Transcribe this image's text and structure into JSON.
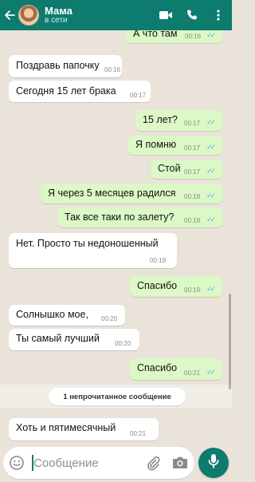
{
  "header": {
    "back_icon": "arrow-left-icon",
    "contact_name": "Мама",
    "status": "в сети",
    "icons": [
      "video-call-icon",
      "phone-icon",
      "more-vert-icon"
    ]
  },
  "messages": [
    {
      "dir": "out",
      "text": "А что там",
      "time": "00:16",
      "read": true
    },
    {
      "dir": "in",
      "text": "Поздравь папочку",
      "time": "00:16"
    },
    {
      "dir": "in",
      "text": "Сегодня 15 лет брака",
      "time": "00:17"
    },
    {
      "dir": "out",
      "text": "15 лет?",
      "time": "00:17",
      "read": true
    },
    {
      "dir": "out",
      "text": "Я помню",
      "time": "00:17",
      "read": true
    },
    {
      "dir": "out",
      "text": "Стой",
      "time": "00:17",
      "read": true
    },
    {
      "dir": "out",
      "text": "Я через 5 месяцев радился",
      "time": "00:18",
      "read": true
    },
    {
      "dir": "out",
      "text": "Так все таки по залету?",
      "time": "00:18",
      "read": true
    },
    {
      "dir": "in",
      "text": "Нет. Просто ты недоношенный",
      "time": "00:19"
    },
    {
      "dir": "out",
      "text": "Спасибо",
      "time": "00:19",
      "read": true
    },
    {
      "dir": "in",
      "text": "Солнышко мое,",
      "time": "00:20"
    },
    {
      "dir": "in",
      "text": "Ты самый лучший",
      "time": "00:20"
    },
    {
      "dir": "out",
      "text": "Спасибо",
      "time": "00:21",
      "read": true
    },
    {
      "dir": "in",
      "text": "Хоть и пятимесячный",
      "time": "00:21"
    }
  ],
  "unread_banner": "1 непрочитанное сообщение",
  "composer": {
    "placeholder": "Сообщение",
    "icons": [
      "emoji-icon",
      "attach-icon",
      "camera-icon",
      "mic-icon"
    ]
  },
  "colors": {
    "header": "#0d7b6e",
    "outgoing_bubble": "#dcf8c6",
    "incoming_bubble": "#ffffff",
    "read_ticks": "#4fb6ec",
    "background": "#e9e3da"
  }
}
